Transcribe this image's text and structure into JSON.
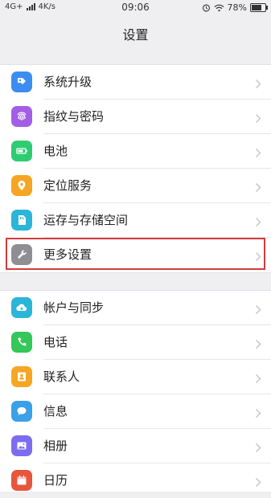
{
  "status_bar": {
    "network": "4G+",
    "speed": "4K/s",
    "time": "09:06",
    "battery": "78%",
    "battery_level": 0.78
  },
  "title": "设置",
  "groups": [
    {
      "items": [
        {
          "label": "系统升级",
          "icon": "system-update-icon",
          "color": "#3b8ef0"
        },
        {
          "label": "指纹与密码",
          "icon": "fingerprint-icon",
          "color": "#a35ee6"
        },
        {
          "label": "电池",
          "icon": "battery-icon",
          "color": "#2ecc71"
        },
        {
          "label": "定位服务",
          "icon": "location-icon",
          "color": "#f5a623"
        },
        {
          "label": "运存与存储空间",
          "icon": "storage-icon",
          "color": "#2bb5d8"
        },
        {
          "label": "更多设置",
          "icon": "wrench-icon",
          "color": "#8e8e93"
        }
      ]
    },
    {
      "items": [
        {
          "label": "帐户与同步",
          "icon": "cloud-icon",
          "color": "#2bb5d8"
        },
        {
          "label": "电话",
          "icon": "phone-icon",
          "color": "#34c759"
        },
        {
          "label": "联系人",
          "icon": "contact-icon",
          "color": "#f5a623"
        },
        {
          "label": "信息",
          "icon": "message-icon",
          "color": "#3aa0e8"
        },
        {
          "label": "相册",
          "icon": "gallery-icon",
          "color": "#7b6cf0"
        },
        {
          "label": "日历",
          "icon": "calendar-icon",
          "color": "#e8553d"
        }
      ]
    }
  ]
}
